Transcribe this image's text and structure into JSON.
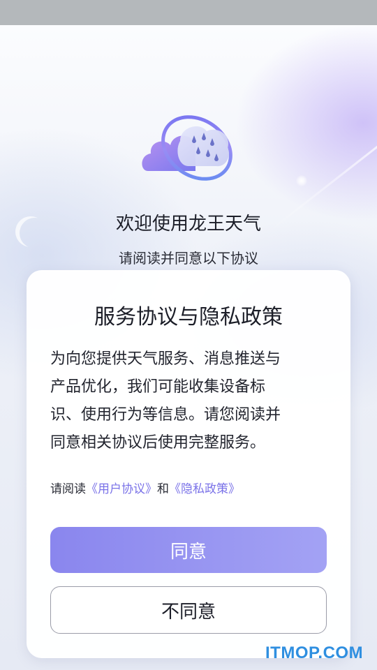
{
  "app": {
    "welcome_title": "欢迎使用龙王天气",
    "welcome_subtitle": "请阅读并同意以下协议"
  },
  "dialog": {
    "title": "服务协议与隐私政策",
    "body_lines": [
      "为向您提供天气服务、消息推送与",
      "产品优化，我们可能收集设备标",
      "识、使用行为等信息。请您阅读并",
      "同意相关协议后使用完整服务。"
    ],
    "consent_prefix": "请阅读",
    "user_agreement_link": "《用户协议》",
    "consent_and": "和",
    "privacy_policy_link": "《隐私政策》",
    "agree_label": "同意",
    "decline_label": "不同意"
  },
  "watermark": "ITMOP.COM",
  "colors": {
    "accent": "#8a86ee",
    "link": "#7a72e8",
    "status_bar": "#b4b8bb",
    "watermark": "#2f8fe0"
  },
  "icons": [
    "weather-logo-icon"
  ]
}
